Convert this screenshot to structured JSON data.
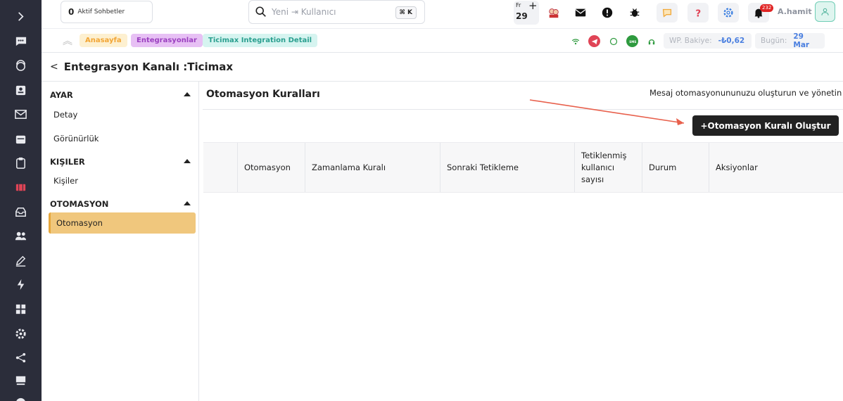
{
  "topbar": {
    "active_chats_count": "0",
    "active_chats_label": "Aktif Sohbetler",
    "search_placeholder": "Yeni ⇥ Kullanıcı",
    "search_shortcut": "⌘ K",
    "date_weekday": "Fr",
    "date_day": "29",
    "notification_count": "232",
    "username": "A.hamit"
  },
  "breadcrumb": {
    "items": [
      "Anasayfa",
      "Entegrasyonlar",
      "Ticimax Integration Detail"
    ],
    "wp_balance_label": "WP. Bakiye:",
    "wp_balance_value": "-₺0,62",
    "today_label": "Bugün:",
    "today_value": "29 Mar"
  },
  "page": {
    "title": "Entegrasyon Kanalı :Ticimax"
  },
  "sidemenu": {
    "sections": [
      {
        "title": "AYAR",
        "items": [
          "Detay",
          "Görünürlük"
        ]
      },
      {
        "title": "KIŞILER",
        "items": [
          "Kişiler"
        ]
      },
      {
        "title": "OTOMASYON",
        "items": [
          "Otomasyon"
        ]
      }
    ],
    "active_item": "Otomasyon"
  },
  "main": {
    "title": "Otomasyon Kuralları",
    "subtitle": "Mesaj otomasyonununuzu oluşturun ve yönetin",
    "create_button": "+Otomasyon Kuralı Oluştur",
    "table_headers": [
      "",
      "Otomasyon",
      "Zamanlama Kuralı",
      "Sonraki Tetikleme",
      "Tetiklenmiş kullanıcı sayısı",
      "Durum",
      "Aksiyonlar"
    ]
  },
  "colors": {
    "rail": "#2b2d3a",
    "accent_active": "#f0c77d",
    "button": "#222222",
    "annotation_arrow": "#e8604c"
  }
}
